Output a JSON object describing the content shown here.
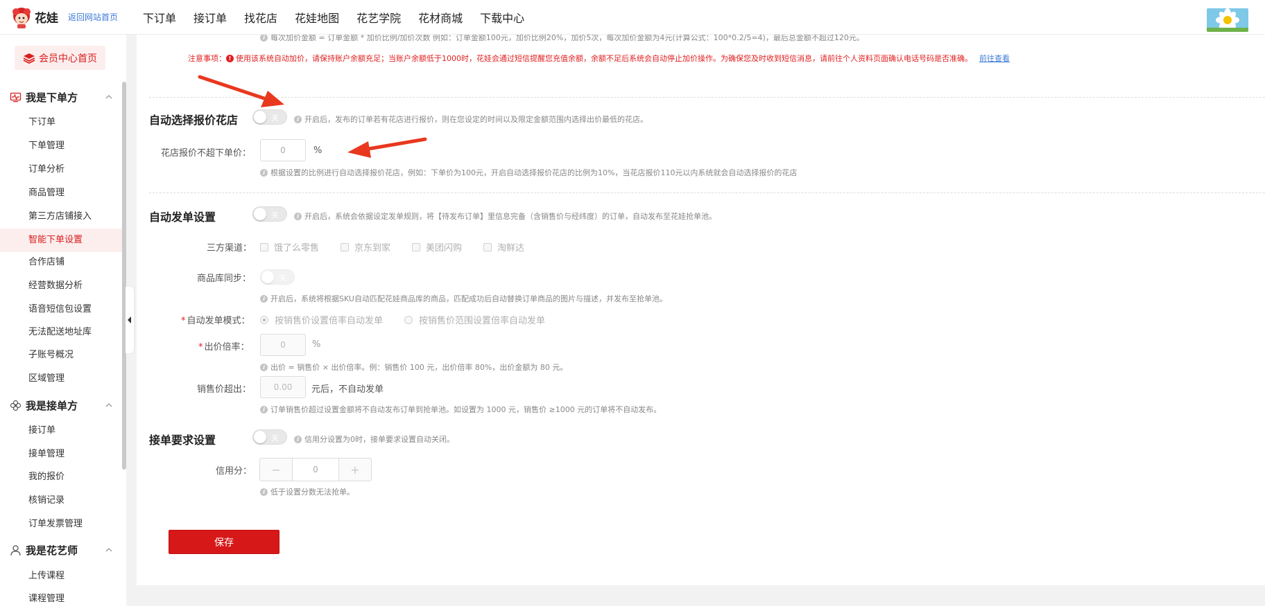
{
  "header": {
    "brand": "花娃",
    "home_link": "返回网站首页",
    "nav": [
      "下订单",
      "接订单",
      "找花店",
      "花娃地图",
      "花艺学院",
      "花材商城",
      "下载中心"
    ]
  },
  "sidebar": {
    "member_button": "会员中心首页",
    "groups": [
      {
        "title": "我是下单方",
        "items": [
          "下订单",
          "下单管理",
          "订单分析",
          "商品管理",
          "第三方店铺接入",
          "智能下单设置",
          "合作店铺",
          "经营数据分析",
          "语音短信包设置",
          "无法配送地址库",
          "子账号概况",
          "区域管理"
        ]
      },
      {
        "title": "我是接单方",
        "items": [
          "接订单",
          "接单管理",
          "我的报价",
          "核销记录",
          "订单发票管理"
        ]
      },
      {
        "title": "我是花艺师",
        "items": [
          "上传课程",
          "课程管理"
        ]
      }
    ]
  },
  "main": {
    "top_partial_note": "每次加价金额 = 订单金额 * 加价比例/加价次数 例如：订单金额100元，加价比例20%，加价5次，每次加价金额为4元(计算公式：100*0.2/5=4)，最后总金额不超过120元。",
    "notice_label": "注意事项：",
    "notice_text": "使用该系统自动加价，请保持账户余额充足；当账户余额低于1000时，花娃会通过短信提醒您充值余额，余额不足后系统会自动停止加价操作。为确保您及时收到短信消息，请前往个人资料页面确认电话号码是否准确。",
    "notice_link": "前往查看",
    "auto_select": {
      "title": "自动选择报价花店",
      "toggle_label": "关",
      "hint": "开启后，发布的订单若有花店进行报价，则在您设定的时间以及限定金额范围内选择出价最低的花店。",
      "field_label": "花店报价不超下单价：",
      "field_value": "0",
      "field_suffix": "%",
      "field_hint": "根据设置的比例进行自动选择报价花店，例如：下单价为100元，开启自动选择报价花店的比例为10%，当花店报价110元以内系统就会自动选择报价的花店"
    },
    "auto_dispatch": {
      "title": "自动发单设置",
      "toggle_label": "关",
      "hint": "开启后，系统会依据设定发单规则，将【待发布订单】里信息完备（含销售价与经纬度）的订单，自动发布至花娃抢单池。",
      "channels_label": "三方渠道：",
      "channels": [
        "饿了么零售",
        "京东到家",
        "美团闪购",
        "淘鲜达"
      ],
      "sync_label": "商品库同步：",
      "sync_toggle": "关",
      "sync_hint": "开启后，系统将根据SKU自动匹配花娃商品库的商品，匹配成功后自动替换订单商品的图片与描述，并发布至抢单池。",
      "mode_label": "自动发单模式：",
      "mode_options": [
        "按销售价设置倍率自动发单",
        "按销售价范围设置倍率自动发单"
      ],
      "rate_label": "出价倍率：",
      "rate_value": "0",
      "rate_suffix": "%",
      "rate_hint": "出价 = 销售价 × 出价倍率。例：销售价 100 元，出价倍率 80%，出价金额为 80 元。",
      "exceed_label": "销售价超出：",
      "exceed_value": "0.00",
      "exceed_suffix": "元后，不自动发单",
      "exceed_hint": "订单销售价超过设置金额将不自动发布订单到抢单池。如设置为 1000 元，销售价 ≥1000 元的订单将不自动发布。"
    },
    "order_req": {
      "title": "接单要求设置",
      "toggle_label": "关",
      "hint": "信用分设置为0时，接单要求设置自动关闭。",
      "credit_label": "信用分：",
      "credit_value": "0",
      "credit_minus": "−",
      "credit_plus": "+",
      "credit_hint": "低于设置分数无法抢单。"
    },
    "save_button": "保存"
  },
  "colors": {
    "accent": "#d71818",
    "link": "#3d7bd8",
    "warning": "#e02020",
    "annotation_arrow": "#e8381f"
  },
  "icons": [
    "logo-mascot",
    "red-envelope-icon",
    "monitor-icon",
    "flower-icon",
    "person-icon",
    "chevron-up-icon",
    "info-icon",
    "collapse-arrow-icon"
  ]
}
